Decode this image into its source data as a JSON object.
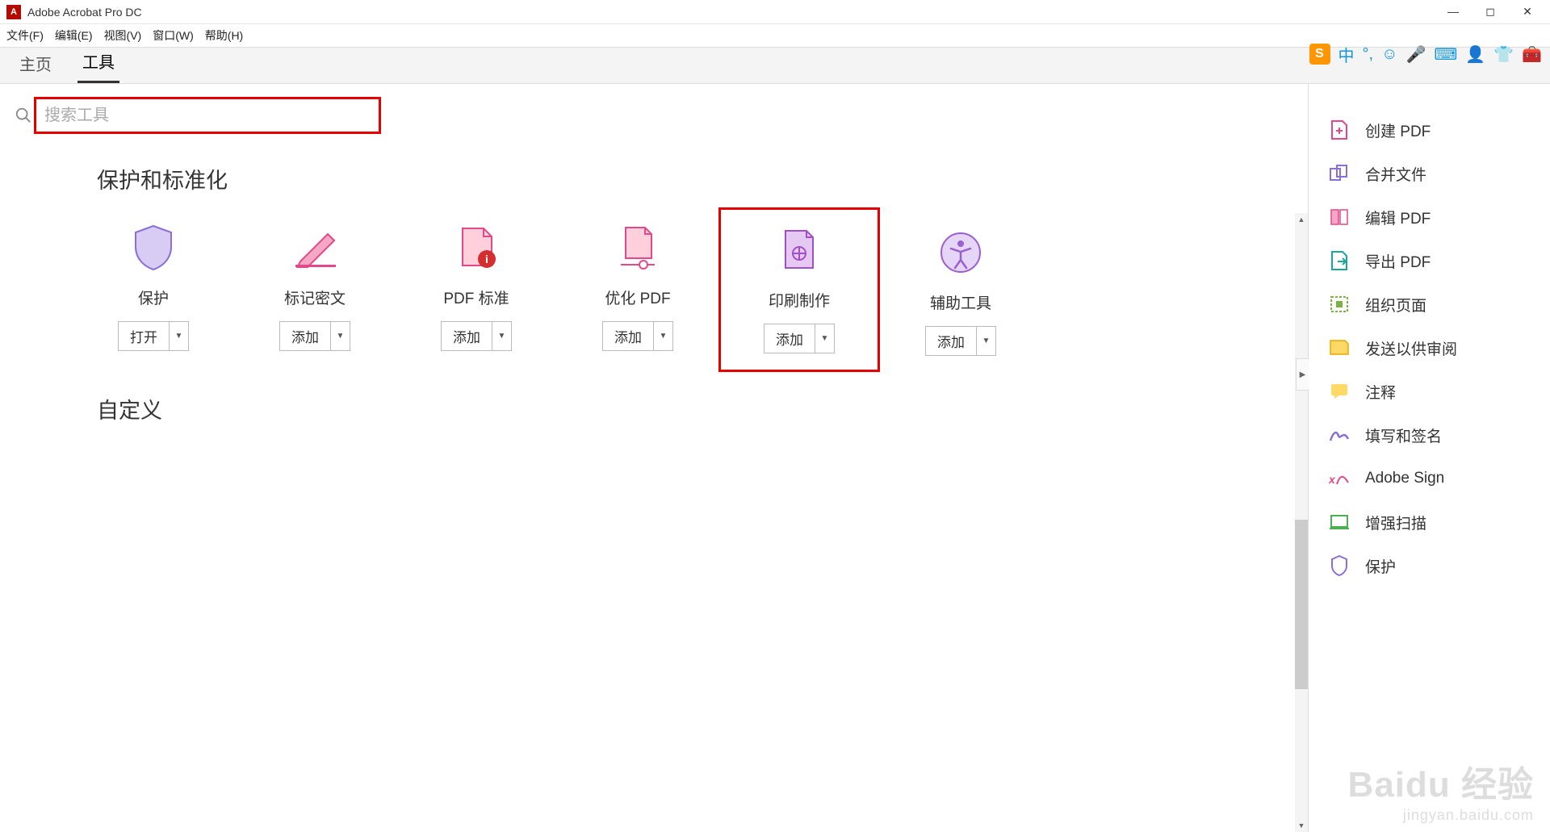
{
  "app": {
    "title": "Adobe Acrobat Pro DC",
    "logo_letter": "A"
  },
  "menu": [
    "文件(F)",
    "编辑(E)",
    "视图(V)",
    "窗口(W)",
    "帮助(H)"
  ],
  "tabs": {
    "home": "主页",
    "tools": "工具"
  },
  "search": {
    "placeholder": "搜索工具"
  },
  "section1": {
    "title": "保护和标准化"
  },
  "section2": {
    "title": "自定义"
  },
  "tools": {
    "protect": {
      "label": "保护",
      "button": "打开"
    },
    "redact": {
      "label": "标记密文",
      "button": "添加"
    },
    "pdfstd": {
      "label": "PDF 标准",
      "button": "添加"
    },
    "optimize": {
      "label": "优化 PDF",
      "button": "添加"
    },
    "print": {
      "label": "印刷制作",
      "button": "添加"
    },
    "access": {
      "label": "辅助工具",
      "button": "添加"
    }
  },
  "right": [
    "创建 PDF",
    "合并文件",
    "编辑 PDF",
    "导出 PDF",
    "组织页面",
    "发送以供审阅",
    "注释",
    "填写和签名",
    "Adobe Sign",
    "增强扫描",
    "保护"
  ],
  "ime": {
    "lang": "中"
  },
  "watermark": {
    "main": "Baidu 经验",
    "sub": "jingyan.baidu.com"
  }
}
